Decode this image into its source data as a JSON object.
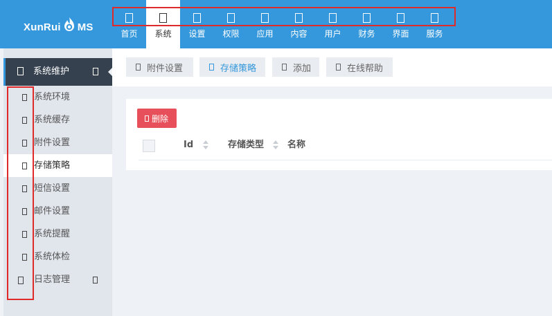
{
  "header": {
    "logo_pre": "XunRui",
    "logo_post": "MS",
    "nav": [
      {
        "label": "首页",
        "icon": "home-icon"
      },
      {
        "label": "系统",
        "icon": "cog-icon"
      },
      {
        "label": "设置",
        "icon": "settings-icon"
      },
      {
        "label": "权限",
        "icon": "lock-icon"
      },
      {
        "label": "应用",
        "icon": "app-icon"
      },
      {
        "label": "内容",
        "icon": "content-icon"
      },
      {
        "label": "用户",
        "icon": "user-icon"
      },
      {
        "label": "财务",
        "icon": "finance-icon"
      },
      {
        "label": "界面",
        "icon": "ui-icon"
      },
      {
        "label": "服务",
        "icon": "service-icon"
      }
    ],
    "active_nav": "系统"
  },
  "sidebar": {
    "head_title": "系统维护",
    "items": [
      {
        "label": "系统环境"
      },
      {
        "label": "系统缓存"
      },
      {
        "label": "附件设置"
      },
      {
        "label": "存储策略"
      },
      {
        "label": "短信设置"
      },
      {
        "label": "邮件设置"
      },
      {
        "label": "系统提醒"
      },
      {
        "label": "系统体检"
      },
      {
        "label": "日志管理"
      }
    ],
    "active_item": "存储策略"
  },
  "toolbar": {
    "buttons": [
      {
        "label": "附件设置"
      },
      {
        "label": "存储策略"
      },
      {
        "label": "添加"
      },
      {
        "label": "在线帮助"
      }
    ]
  },
  "table": {
    "delete_label": "删除",
    "columns": [
      "Id",
      "存储类型",
      "名称"
    ]
  },
  "colors": {
    "header_bg": "#3598dc",
    "sidebar_head_bg": "#364150",
    "delete_bg": "#e7505a",
    "highlight_border": "#e02a2a"
  }
}
